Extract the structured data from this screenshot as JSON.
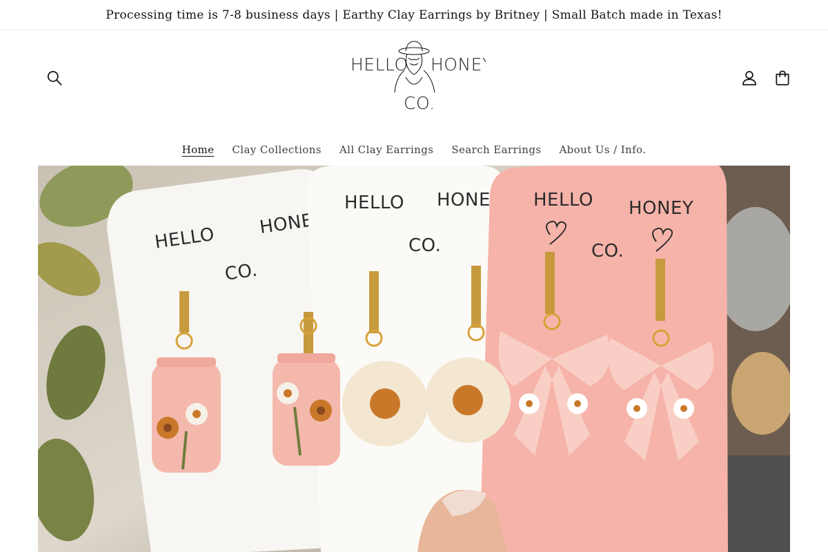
{
  "announcement": {
    "text": "Processing time is 7-8 business days | Earthy Clay Earrings by Britney | Small Batch made in Texas!"
  },
  "header": {
    "search_icon": "search-icon",
    "account_icon": "account-icon",
    "cart_icon": "cart-icon",
    "logo": {
      "left_word": "HELLO",
      "right_word": "HONEY",
      "bottom_word": "CO."
    }
  },
  "nav": {
    "items": [
      {
        "label": "Home",
        "active": true
      },
      {
        "label": "Clay Collections",
        "active": false
      },
      {
        "label": "All Clay Earrings",
        "active": false
      },
      {
        "label": "Search Earrings",
        "active": false
      },
      {
        "label": "About Us / Info.",
        "active": false
      }
    ]
  },
  "hero": {
    "cards": [
      {
        "left_word": "HELLO",
        "right_word": "HONEY",
        "bottom_word": "CO."
      },
      {
        "left_word": "HELLO",
        "right_word": "HONEY",
        "bottom_word": "CO."
      },
      {
        "left_word": "HELLO",
        "right_word": "HONEY",
        "bottom_word": "CO."
      }
    ]
  },
  "colors": {
    "text": "#121212",
    "card_white": "#f7f6f3",
    "card_pink": "#f6b3a9",
    "gold": "#c79a3e",
    "clay_pink": "#f4b8ac",
    "clay_cream": "#f4e7d2",
    "flower_orange": "#c9782a"
  }
}
